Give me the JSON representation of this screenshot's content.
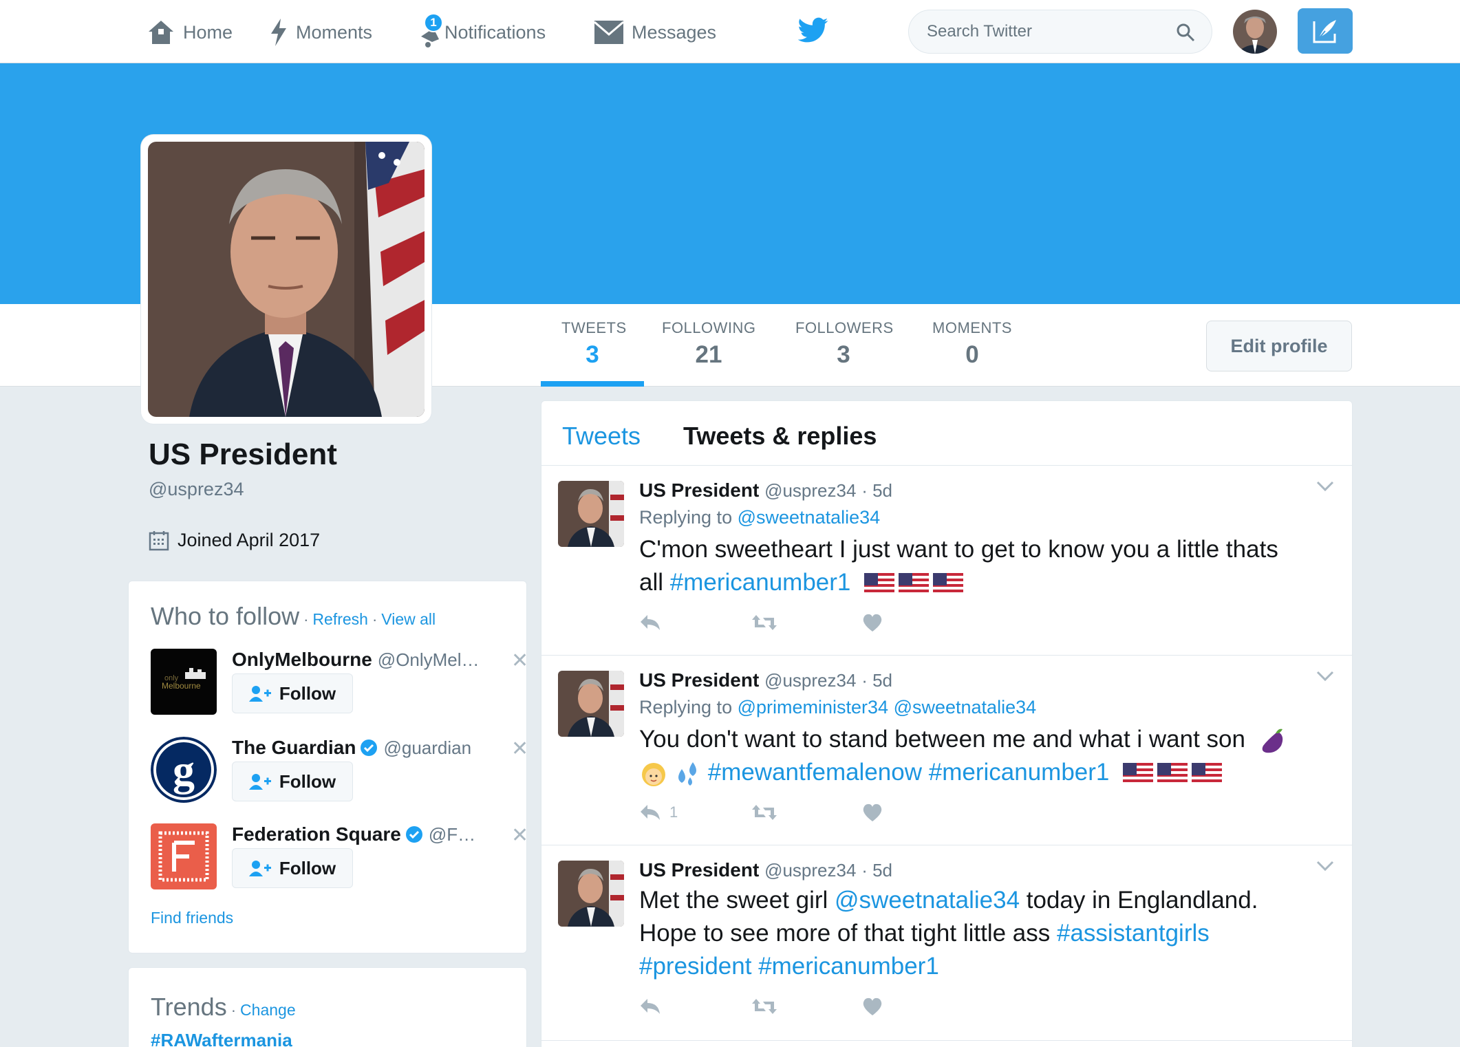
{
  "nav": {
    "home": "Home",
    "moments": "Moments",
    "notifications": "Notifications",
    "notifications_badge": "1",
    "messages": "Messages",
    "search_placeholder": "Search Twitter"
  },
  "colors": {
    "brand": "#1da1f2",
    "banner": "#2aa2ec",
    "link": "#1b95e0"
  },
  "profile_nav": {
    "stats": [
      {
        "label": "TWEETS",
        "value": "3"
      },
      {
        "label": "FOLLOWING",
        "value": "21"
      },
      {
        "label": "FOLLOWERS",
        "value": "3"
      },
      {
        "label": "MOMENTS",
        "value": "0"
      }
    ],
    "edit_profile": "Edit profile"
  },
  "profile": {
    "name": "US President",
    "handle": "@usprez34",
    "joined": "Joined April 2017"
  },
  "who_to_follow": {
    "title": "Who to follow",
    "refresh": "Refresh",
    "view_all": "View all",
    "follow_label": "Follow",
    "find_friends": "Find friends",
    "suggestions": [
      {
        "name": "OnlyMelbourne",
        "handle": "@OnlyMel…",
        "verified": false,
        "avatar_icon": "onlymelbourne-logo",
        "avatar_text": "only Melbourne"
      },
      {
        "name": "The Guardian",
        "handle": "@guardian",
        "verified": true,
        "avatar_icon": "guardian-logo"
      },
      {
        "name": "Federation Square",
        "handle": "@F…",
        "verified": true,
        "avatar_icon": "federation-square-logo"
      }
    ]
  },
  "trends": {
    "title": "Trends",
    "change": "Change",
    "items": [
      "#RAWaftermania"
    ]
  },
  "timeline": {
    "tabs": [
      "Tweets",
      "Tweets & replies"
    ],
    "tweets": [
      {
        "name": "US President",
        "handle": "@usprez34",
        "time": "· 5d",
        "replying_prefix": "Replying to",
        "replying_to": "@sweetnatalie34",
        "text_1": "C'mon sweetheart I just want to get to know you a little thats",
        "text_2": "all",
        "hashtag_1": "#mericanumber1",
        "emoji": [
          "us-flag",
          "us-flag",
          "us-flag"
        ],
        "reply_count": ""
      },
      {
        "name": "US President",
        "handle": "@usprez34",
        "time": "· 5d",
        "replying_prefix": "Replying to",
        "replying_to": "@primeminister34 @sweetnatalie34",
        "text_1": "You don't want to stand between me and what i want son",
        "hashtag_1": "#mewantfemalenow",
        "hashtag_2": "#mericanumber1",
        "emoji": [
          "eggplant",
          "blonde-woman",
          "sweat-droplets",
          "us-flag",
          "us-flag",
          "us-flag"
        ],
        "reply_count": "1"
      },
      {
        "name": "US President",
        "handle": "@usprez34",
        "time": "· 5d",
        "text_1": "Met the sweet girl",
        "mention": "@sweetnatalie34",
        "text_2": "today in Englandland.",
        "text_3": "Hope to see more of that tight little ass",
        "hashtag_1": "#assistantgirls",
        "hashtag_2": "#president",
        "hashtag_3": "#mericanumber1",
        "reply_count": ""
      }
    ]
  }
}
